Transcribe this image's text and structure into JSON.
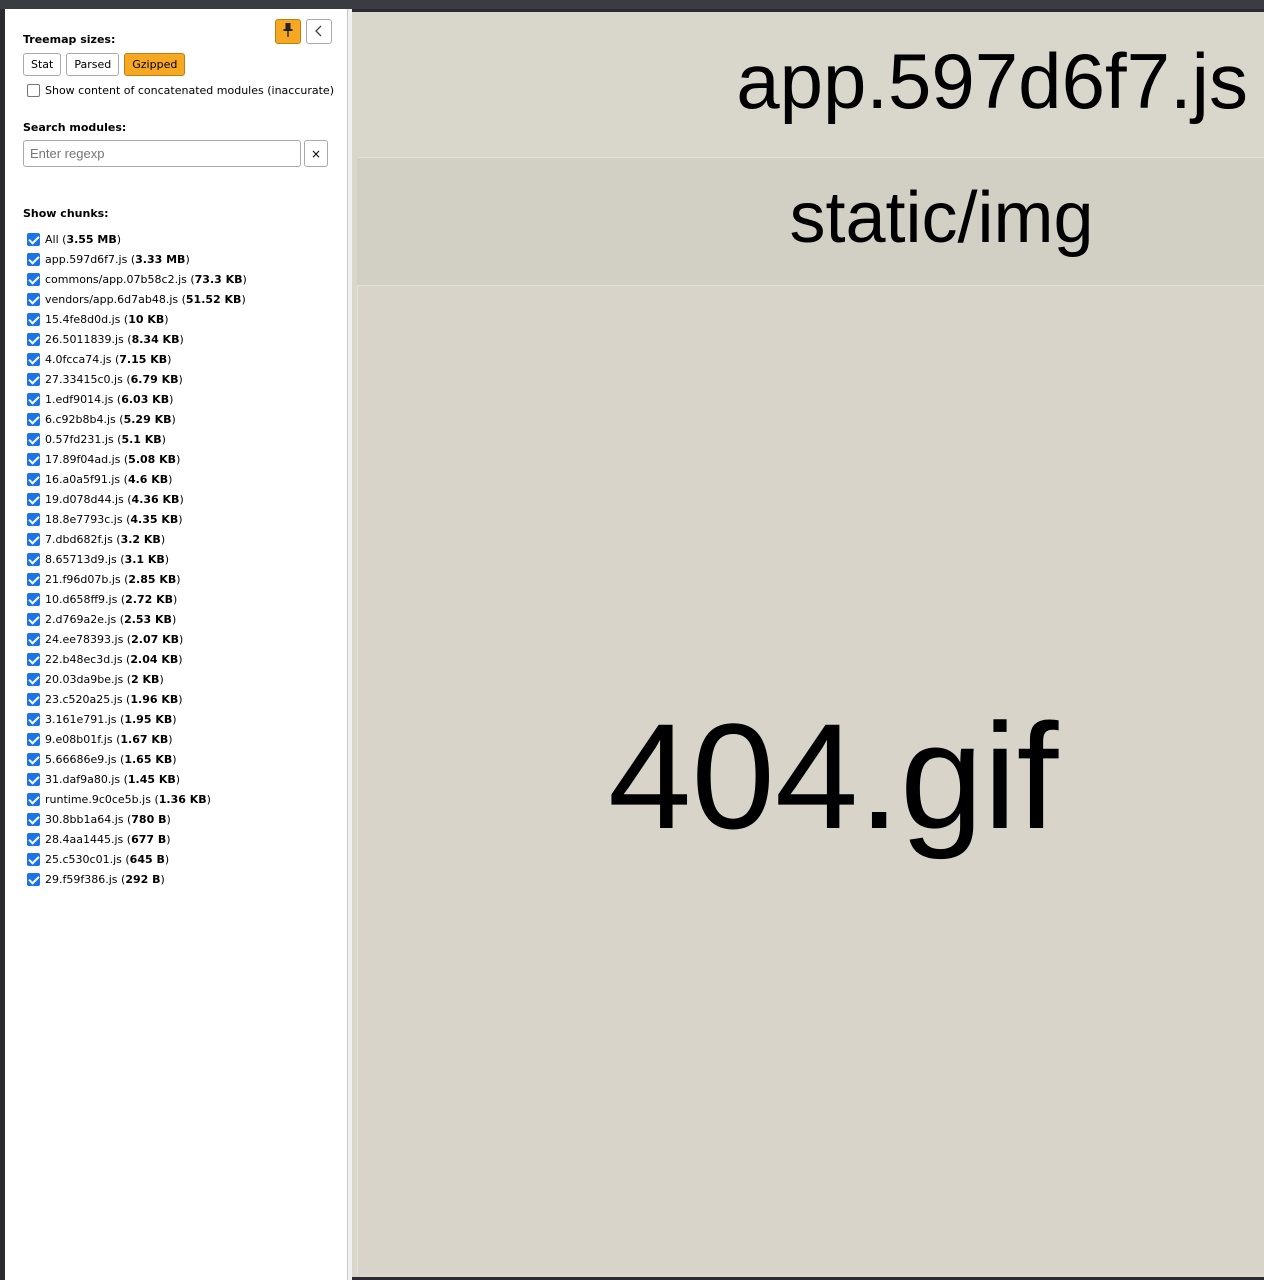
{
  "sidebar": {
    "treemap_sizes_label": "Treemap sizes:",
    "size_buttons": [
      {
        "label": "Stat",
        "active": false
      },
      {
        "label": "Parsed",
        "active": false
      },
      {
        "label": "Gzipped",
        "active": true
      }
    ],
    "concat_label": "Show content of concatenated modules (inaccurate)",
    "concat_checked": false,
    "search_label": "Search modules:",
    "search_placeholder": "Enter regexp",
    "search_clear_label": "×",
    "chunks_label": "Show chunks:",
    "chunks": [
      {
        "name": "All",
        "size": "3.55 MB"
      },
      {
        "name": "app.597d6f7.js",
        "size": "3.33 MB"
      },
      {
        "name": "commons/app.07b58c2.js",
        "size": "73.3 KB"
      },
      {
        "name": "vendors/app.6d7ab48.js",
        "size": "51.52 KB"
      },
      {
        "name": "15.4fe8d0d.js",
        "size": "10 KB"
      },
      {
        "name": "26.5011839.js",
        "size": "8.34 KB"
      },
      {
        "name": "4.0fcca74.js",
        "size": "7.15 KB"
      },
      {
        "name": "27.33415c0.js",
        "size": "6.79 KB"
      },
      {
        "name": "1.edf9014.js",
        "size": "6.03 KB"
      },
      {
        "name": "6.c92b8b4.js",
        "size": "5.29 KB"
      },
      {
        "name": "0.57fd231.js",
        "size": "5.1 KB"
      },
      {
        "name": "17.89f04ad.js",
        "size": "5.08 KB"
      },
      {
        "name": "16.a0a5f91.js",
        "size": "4.6 KB"
      },
      {
        "name": "19.d078d44.js",
        "size": "4.36 KB"
      },
      {
        "name": "18.8e7793c.js",
        "size": "4.35 KB"
      },
      {
        "name": "7.dbd682f.js",
        "size": "3.2 KB"
      },
      {
        "name": "8.65713d9.js",
        "size": "3.1 KB"
      },
      {
        "name": "21.f96d07b.js",
        "size": "2.85 KB"
      },
      {
        "name": "10.d658ff9.js",
        "size": "2.72 KB"
      },
      {
        "name": "2.d769a2e.js",
        "size": "2.53 KB"
      },
      {
        "name": "24.ee78393.js",
        "size": "2.07 KB"
      },
      {
        "name": "22.b48ec3d.js",
        "size": "2.04 KB"
      },
      {
        "name": "20.03da9be.js",
        "size": "2 KB"
      },
      {
        "name": "23.c520a25.js",
        "size": "1.96 KB"
      },
      {
        "name": "3.161e791.js",
        "size": "1.95 KB"
      },
      {
        "name": "9.e08b01f.js",
        "size": "1.67 KB"
      },
      {
        "name": "5.66686e9.js",
        "size": "1.65 KB"
      },
      {
        "name": "31.daf9a80.js",
        "size": "1.45 KB"
      },
      {
        "name": "runtime.9c0ce5b.js",
        "size": "1.36 KB"
      },
      {
        "name": "30.8bb1a64.js",
        "size": "780 B"
      },
      {
        "name": "28.4aa1445.js",
        "size": "677 B"
      },
      {
        "name": "25.c530c01.js",
        "size": "645 B"
      },
      {
        "name": "29.f59f386.js",
        "size": "292 B"
      }
    ]
  },
  "treemap": {
    "root_label": "app.597d6f7.js",
    "folder_label": "static/img",
    "file_label": "404.gif"
  },
  "colors": {
    "accent": "#f7a823",
    "checkbox": "#1a73e8",
    "treemap_bg": "#d9d6cc"
  },
  "icons": {
    "pin": "pin-icon",
    "collapse": "chevron-left-icon"
  }
}
